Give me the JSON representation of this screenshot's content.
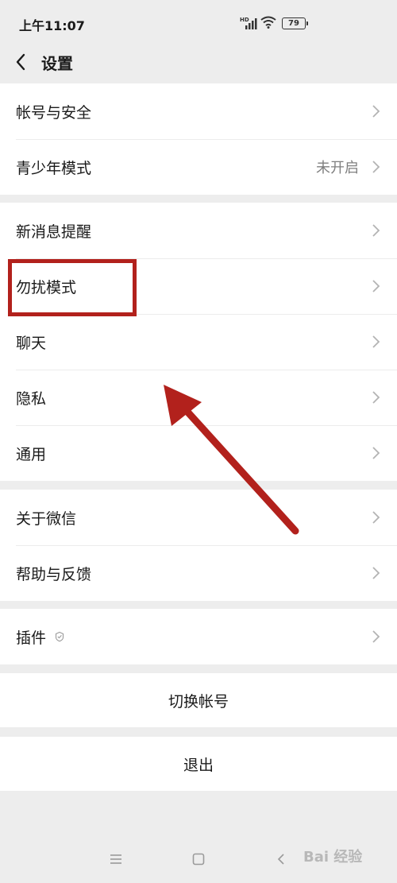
{
  "status_bar": {
    "time": "上午11:07",
    "network_label": "HD",
    "battery_level": "79"
  },
  "header": {
    "title": "设置"
  },
  "groups": [
    {
      "items": [
        {
          "label": "帐号与安全",
          "value": ""
        },
        {
          "label": "青少年模式",
          "value": "未开启"
        }
      ]
    },
    {
      "items": [
        {
          "label": "新消息提醒",
          "value": ""
        },
        {
          "label": "勿扰模式",
          "value": ""
        },
        {
          "label": "聊天",
          "value": ""
        },
        {
          "label": "隐私",
          "value": ""
        },
        {
          "label": "通用",
          "value": ""
        }
      ]
    },
    {
      "items": [
        {
          "label": "关于微信",
          "value": ""
        },
        {
          "label": "帮助与反馈",
          "value": ""
        }
      ]
    },
    {
      "items": [
        {
          "label": "插件",
          "value": ""
        }
      ]
    }
  ],
  "actions": {
    "switch_account": "切换帐号",
    "logout": "退出"
  },
  "annotation": {
    "highlight_color": "#b2211c",
    "arrow_color": "#b2211c"
  },
  "icons": {
    "back": "chevron-left-icon",
    "chevron": "chevron-right-icon",
    "plugin_badge": "plugin-badge-icon",
    "menu": "menu-icon",
    "home": "home-square-icon",
    "system_back": "system-back-icon"
  },
  "watermark": {
    "text": "Bai 经验"
  }
}
